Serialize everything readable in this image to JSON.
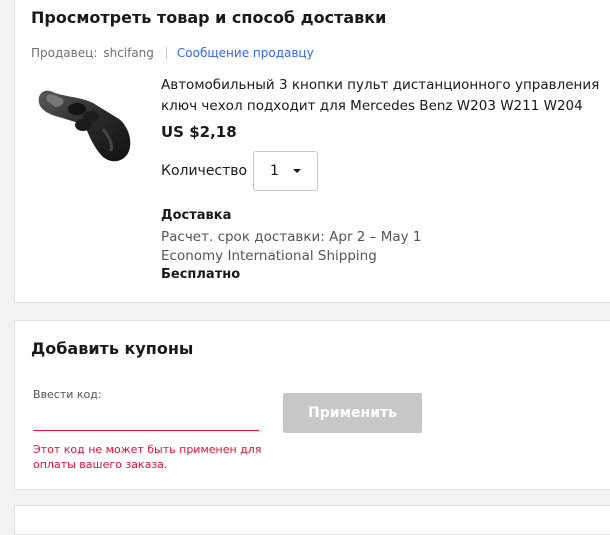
{
  "order_section": {
    "title": "Просмотреть товар и способ доставки",
    "seller_label": "Продавец:",
    "seller_name": "shcifang",
    "message_link": "Сообщение продавцу",
    "product": {
      "title": "Автомобильный 3 кнопки пульт дистанционного управления ключ чехол подходит для Mercedes Benz W203 W211 W204",
      "price": "US $2,18",
      "quantity_label": "Количество",
      "quantity_value": "1"
    },
    "shipping": {
      "heading": "Доставка",
      "estimate": "Расчет. срок доставки: Apr 2 – May 1",
      "method": "Economy International Shipping",
      "cost": "Бесплатно"
    }
  },
  "coupon_section": {
    "title": "Добавить купоны",
    "code_label": "Ввести код:",
    "code_value": "",
    "apply_label": "Применить",
    "error_text": "Этот код не может быть применен для оплаты вашего заказа."
  },
  "colors": {
    "link": "#3665f3",
    "error": "#e0103a",
    "button_disabled": "#c7c7c7"
  },
  "icons": {
    "product_image": "car-key-fob-image",
    "quantity_caret": "chevron-down-icon"
  }
}
